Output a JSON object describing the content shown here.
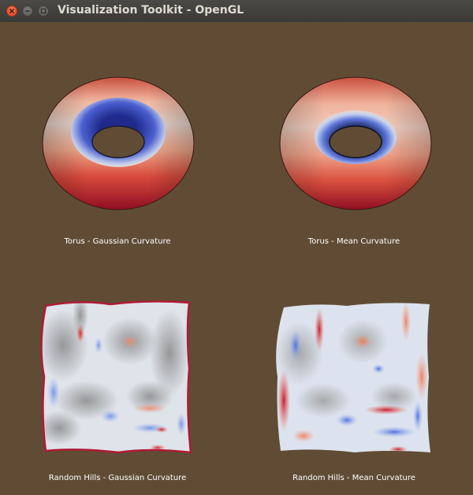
{
  "window": {
    "title": "Visualization Toolkit - OpenGL"
  },
  "colors": {
    "background": "#604c35",
    "low_curvature": "#3a4db3",
    "neutral": "#dde0e6",
    "high_curvature": "#b40426"
  },
  "panels": [
    {
      "caption": "Torus - Gaussian Curvature"
    },
    {
      "caption": "Torus - Mean Curvature"
    },
    {
      "caption": "Random Hills - Gaussian Curvature"
    },
    {
      "caption": "Random Hills - Mean Curvature"
    }
  ]
}
